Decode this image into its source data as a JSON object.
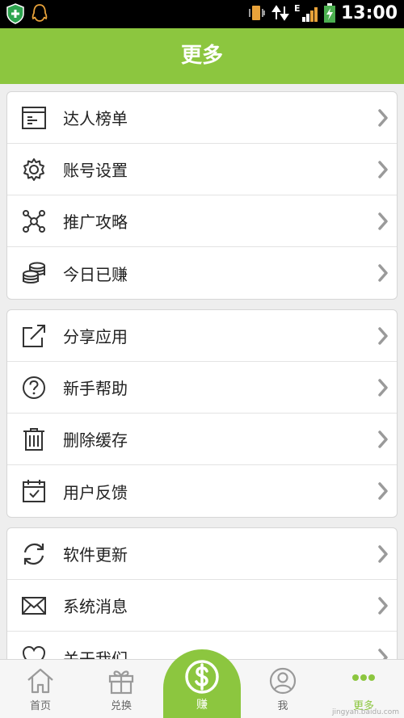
{
  "status_bar": {
    "time": "13:00",
    "network": "E"
  },
  "header": {
    "title": "更多"
  },
  "groups": [
    {
      "items": [
        {
          "label": "达人榜单",
          "icon": "leaderboard-icon"
        },
        {
          "label": "账号设置",
          "icon": "gear-icon"
        },
        {
          "label": "推广攻略",
          "icon": "network-icon"
        },
        {
          "label": "今日已赚",
          "icon": "coins-icon"
        }
      ]
    },
    {
      "items": [
        {
          "label": "分享应用",
          "icon": "share-icon"
        },
        {
          "label": "新手帮助",
          "icon": "help-icon"
        },
        {
          "label": "删除缓存",
          "icon": "trash-icon"
        },
        {
          "label": "用户反馈",
          "icon": "feedback-icon"
        }
      ]
    },
    {
      "items": [
        {
          "label": "软件更新",
          "icon": "refresh-icon"
        },
        {
          "label": "系统消息",
          "icon": "mail-icon"
        },
        {
          "label": "关于我们",
          "icon": "heart-icon"
        }
      ]
    }
  ],
  "tabbar": {
    "home": "首页",
    "exchange": "兑换",
    "earn": "赚",
    "me": "我",
    "more": "更多"
  },
  "colors": {
    "accent": "#8cc63f",
    "chevron": "#9a9a9a"
  },
  "watermark": "jingyan.baidu.com"
}
